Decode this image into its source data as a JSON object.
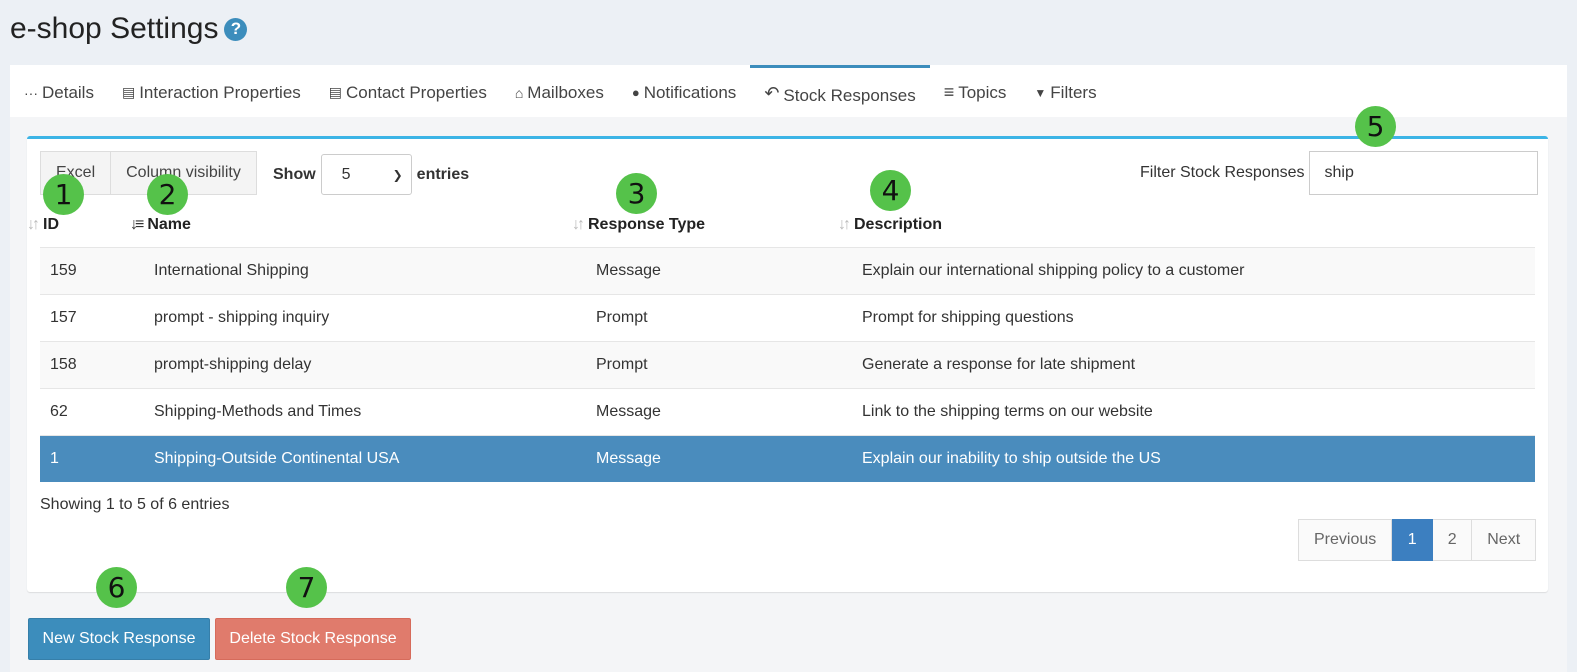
{
  "page": {
    "title": "e-shop Settings",
    "help_icon": "?"
  },
  "tabs": [
    {
      "label": "Details",
      "icon": "···"
    },
    {
      "label": "Interaction Properties",
      "icon": "▤"
    },
    {
      "label": "Contact Properties",
      "icon": "▤"
    },
    {
      "label": "Mailboxes",
      "icon": "⌂"
    },
    {
      "label": "Notifications",
      "icon": "🔔"
    },
    {
      "label": "Stock Responses",
      "icon": "↶",
      "active": true
    },
    {
      "label": "Topics",
      "icon": "≡"
    },
    {
      "label": "Filters",
      "icon": "▼"
    }
  ],
  "toolbar": {
    "excel_label": "Excel",
    "column_visibility_label": "Column visibility",
    "show_label": "Show",
    "entries_label": "entries",
    "page_size": "5",
    "filter_label": "Filter Stock Responses",
    "filter_value": "ship"
  },
  "table": {
    "columns": [
      "ID",
      "Name",
      "Response Type",
      "Description"
    ],
    "rows": [
      {
        "id": "159",
        "name": "International Shipping",
        "type": "Message",
        "description": "Explain our international shipping policy to a customer"
      },
      {
        "id": "157",
        "name": "prompt - shipping inquiry",
        "type": "Prompt",
        "description": "Prompt for shipping questions"
      },
      {
        "id": "158",
        "name": "prompt-shipping delay",
        "type": "Prompt",
        "description": "Generate a response for late shipment"
      },
      {
        "id": "62",
        "name": "Shipping-Methods and Times",
        "type": "Message",
        "description": "Link to the shipping terms on our website"
      },
      {
        "id": "1",
        "name": "Shipping-Outside Continental USA",
        "type": "Message",
        "description": "Explain our inability to ship outside the US",
        "selected": true
      }
    ]
  },
  "info": "Showing 1 to 5 of 6 entries",
  "pagination": {
    "previous": "Previous",
    "pages": [
      "1",
      "2"
    ],
    "next": "Next",
    "current": "1"
  },
  "actions": {
    "new_label": "New Stock Response",
    "delete_label": "Delete Stock Response"
  },
  "markers": [
    "1",
    "2",
    "3",
    "4",
    "5",
    "6",
    "7"
  ],
  "colors": {
    "accent": "#3c8dbc",
    "selected_row": "#4a8cbd",
    "danger": "#e07b6c",
    "marker": "#55c24a"
  }
}
